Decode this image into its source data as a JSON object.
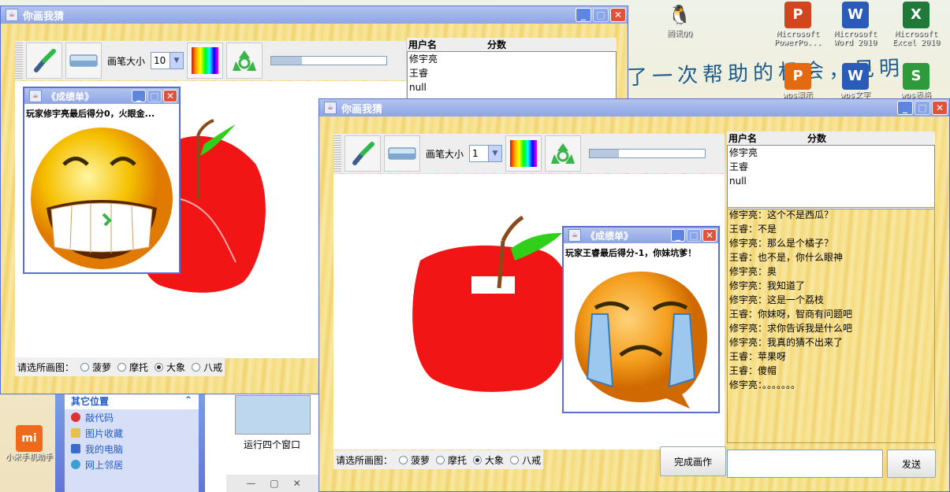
{
  "desktop": {
    "icons": [
      {
        "label": "腾讯QQ",
        "glyph": "🐧",
        "color": "#222222"
      },
      {
        "label": "Microsoft PowerPo...",
        "glyph": "P",
        "color": "#d2461e"
      },
      {
        "label": "Microsoft Word 2010",
        "glyph": "W",
        "color": "#2a5bb8"
      },
      {
        "label": "Microsoft Excel 2010",
        "glyph": "X",
        "color": "#1f7a3a"
      },
      {
        "label": "wps演示",
        "glyph": "P",
        "color": "#e46a12"
      },
      {
        "label": "wps文字",
        "glyph": "W",
        "color": "#2a5bb8"
      },
      {
        "label": "wps表格",
        "glyph": "S",
        "color": "#2f9a3c"
      },
      {
        "label": "小米手机助手",
        "glyph": "mi",
        "color": "#f06a1b"
      }
    ],
    "wallpaper_text": "了一次帮助的机会，见明"
  },
  "explorer": {
    "panel_title": "其它位置",
    "items": [
      "敲代码",
      "图片收藏",
      "我的电脑",
      "网上邻居"
    ],
    "thumb_label": "运行四个窗口"
  },
  "window1": {
    "title": "你画我猜",
    "brush_size_label": "画笔大小",
    "brush_size_value": "10",
    "progress": 0.27,
    "userlist_head": {
      "name": "用户名",
      "score": "分数"
    },
    "users": [
      "修宇亮",
      "王睿",
      "null"
    ],
    "choose_label": "请选所画图：",
    "options": [
      "菠萝",
      "摩托",
      "大象",
      "八戒"
    ],
    "selected_option": "大象"
  },
  "dialog1": {
    "title": "《成绩单》",
    "message": "玩家修宇亮最后得分0，火眼金...",
    "face": "grin"
  },
  "window2": {
    "title": "你画我猜",
    "brush_size_label": "画笔大小",
    "brush_size_value": "1",
    "progress": 0.25,
    "userlist_head": {
      "name": "用户名",
      "score": "分数"
    },
    "users": [
      "修宇亮",
      "王睿",
      "null"
    ],
    "chat": [
      "修宇亮：这个不是西瓜？",
      "王睿：不是",
      "修宇亮：那么是个橘子？",
      "王睿：也不是，你什么眼神",
      "修宇亮：奥",
      "修宇亮：我知道了",
      "修宇亮：这是一个荔枝",
      "王睿：你妹呀，智商有问题吧",
      "修宇亮：求你告诉我是什么吧",
      "修宇亮：我真的猜不出来了",
      "王睿：苹果呀",
      "王睿：傻帽",
      "修宇亮：。。。。。。。"
    ],
    "choose_label": "请选所画图：",
    "options": [
      "菠萝",
      "摩托",
      "大象",
      "八戒"
    ],
    "selected_option": "大象",
    "finish_button": "完成画作",
    "send_button": "发送",
    "input_value": ""
  },
  "dialog2": {
    "title": "《成绩单》",
    "message": "玩家王睿最后得分-1，你妹坑爹！",
    "face": "cry"
  },
  "colors": {
    "title_gradient_start": "#b3c4ee",
    "title_gradient_end": "#8ea4e6",
    "close_button": "#e0533a",
    "apple_red": "#f21515",
    "leaf_green": "#2fcf1a",
    "stem_brown": "#8a4a1c"
  }
}
